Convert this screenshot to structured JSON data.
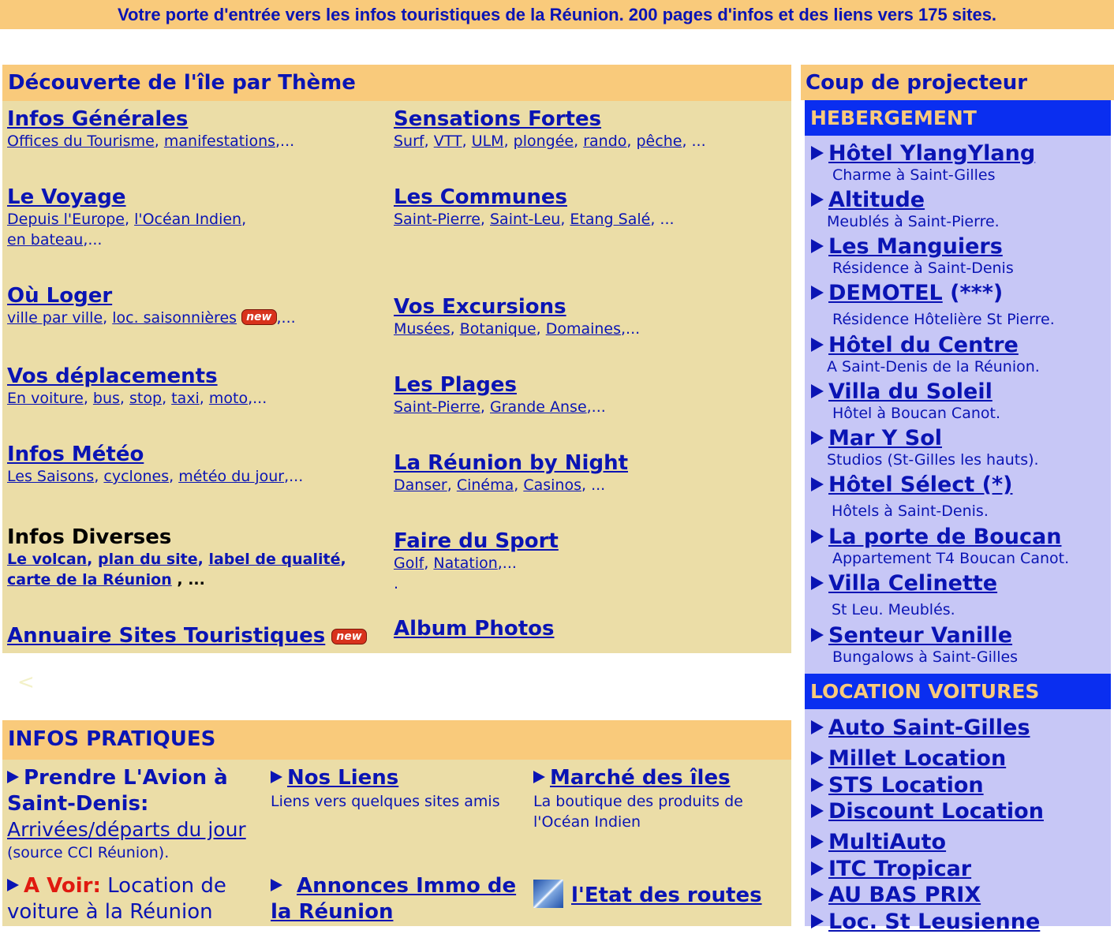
{
  "top_banner": "Votre porte d'entrée vers les infos touristiques de la Réunion. 200 pages d'infos et des liens vers 175 sites.",
  "theme": {
    "header": "Découverte de l'île  par Thème",
    "left": [
      {
        "title": "Infos Générales",
        "links": [
          "Offices du Tourisme",
          "manifestations"
        ],
        "tail": ",..."
      },
      {
        "title": "Le Voyage",
        "links": [
          "Depuis l'Europe",
          "l'Océan Indien"
        ],
        "line2_link": "en bateau",
        "tail": ",..."
      },
      {
        "title": "Où Loger",
        "links": [
          "ville par ville",
          "loc. saisonnières"
        ],
        "badge": "new",
        "tail": ",..."
      },
      {
        "title": "Vos déplacements",
        "links": [
          "En voiture",
          "bus",
          "stop",
          "taxi",
          "moto"
        ],
        "tail": ",..."
      },
      {
        "title": "Infos Météo",
        "links": [
          "Les Saisons",
          "cyclones",
          "météo du jour"
        ],
        "tail": ",..."
      },
      {
        "title": "Infos Diverses",
        "links": [
          "Le volcan",
          "plan du site",
          "label de qualité"
        ],
        "line2_link": "carte de la Réunion",
        "tail": " , ..."
      },
      {
        "title": "Annuaire Sites Touristiques",
        "badge": "new"
      }
    ],
    "right": [
      {
        "title": "Sensations Fortes",
        "links": [
          "Surf",
          "VTT",
          "ULM",
          "plongée",
          "rando",
          "pêche"
        ],
        "tail": ", ..."
      },
      {
        "title": "Les Communes",
        "links": [
          "Saint-Pierre",
          "Saint-Leu",
          "Etang Salé"
        ],
        "tail": ", ..."
      },
      {
        "title": "Vos Excursions",
        "links": [
          "Musées",
          "Botanique",
          "Domaines"
        ],
        "tail": ",..."
      },
      {
        "title": "Les Plages",
        "links": [
          "Saint-Pierre",
          "Grande Anse"
        ],
        "tail": ",..."
      },
      {
        "title": "La Réunion by Night",
        "links": [
          "Danser",
          "Cinéma",
          "Casinos"
        ],
        "tail": ", ..."
      },
      {
        "title": "Faire du Sport",
        "links": [
          "Golf",
          "Natation"
        ],
        "tail": ",...",
        "extra": "."
      },
      {
        "title": "Album Photos"
      }
    ]
  },
  "stray_char": "<",
  "pratiques": {
    "header": "INFOS PRATIQUES",
    "avion_title": "Prendre L'Avion à Saint-Denis:",
    "avion_link": "Arrivées/départs du jour",
    "avion_note": "(source CCI Réunion).",
    "liens_title": "Nos Liens",
    "liens_desc": "Liens vers quelques sites amis",
    "marche_title": "Marché des îles",
    "marche_desc": "La boutique des produits de l'Océan Indien",
    "avoir_label": "A Voir:",
    "avoir_text": "Location de voiture à la Réunion",
    "annonces_title": "Annonces Immo de la Réunion",
    "routes_title": "l'Etat des routes"
  },
  "projecteur": {
    "header": "Coup de projecteur",
    "hebergement_header": "HEBERGEMENT",
    "hebergement": [
      {
        "name": "Hôtel YlangYlang",
        "desc": "Charme à Saint-Gilles"
      },
      {
        "name": "Altitude",
        "desc": "Meublés à Saint-Pierre."
      },
      {
        "name": "Les Manguiers",
        "desc": "Résidence à Saint-Denis"
      },
      {
        "name": "DEMOTEL",
        "suffix": " (***)",
        "desc": "Résidence Hôtelière St Pierre."
      },
      {
        "name": "Hôtel du Centre",
        "desc": "A Saint-Denis de la Réunion."
      },
      {
        "name": "Villa du Soleil",
        "desc": "Hôtel à Boucan Canot."
      },
      {
        "name": "Mar Y Sol",
        "desc": "Studios (St-Gilles les hauts)."
      },
      {
        "name": "Hôtel Sélect (*)",
        "desc": "Hôtels à Saint-Denis."
      },
      {
        "name": "La porte de Boucan",
        "desc": "Appartement T4 Boucan Canot."
      },
      {
        "name": "Villa Celinette",
        "desc": "St Leu. Meublés."
      },
      {
        "name": "Senteur Vanille",
        "desc": "Bungalows à Saint-Gilles"
      }
    ],
    "location_header": "LOCATION VOITURES",
    "location": [
      "Auto Saint-Gilles",
      "Millet Location ",
      "STS Location",
      "Discount Location",
      "MultiAuto ",
      "ITC Tropicar",
      "AU BAS PRIX",
      "Loc. St Leusienne"
    ]
  },
  "colors": {
    "blue_text": "#0a14b4",
    "orange": "#f9ca7b",
    "beige": "#ebdda7",
    "lavender": "#c7c7f6",
    "blue_header": "#0a2ef0"
  }
}
